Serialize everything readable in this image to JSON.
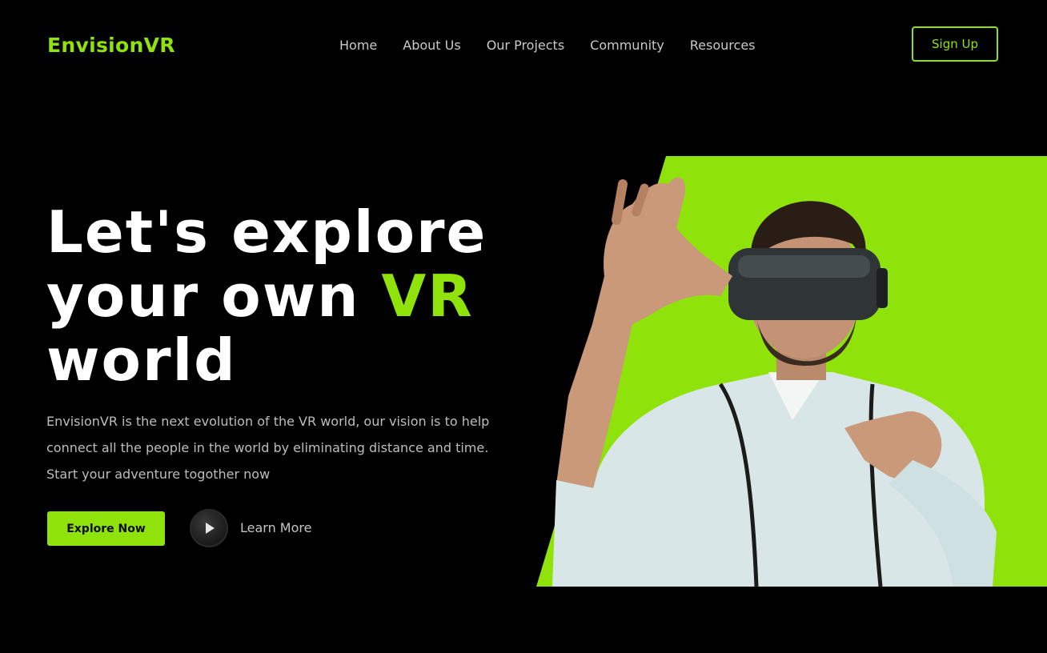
{
  "header": {
    "logo": "EnvisionVR",
    "nav": [
      {
        "label": "Home"
      },
      {
        "label": "About Us"
      },
      {
        "label": "Our Projects"
      },
      {
        "label": "Community"
      },
      {
        "label": "Resources"
      }
    ],
    "signup_label": "Sign Up"
  },
  "hero": {
    "headline_line1": "Let's explore",
    "headline_line2_start": "your own ",
    "headline_line2_accent": "VR",
    "headline_line3": "world",
    "description": "EnvisionVR is the next evolution of the VR world, our vision is to help connect all the people in the world by eliminating distance and time. Start your adventure togother now",
    "explore_label": "Explore Now",
    "learn_more_label": "Learn More",
    "image_icon": "vr-headset-person-image"
  },
  "colors": {
    "accent": "#8fe30a",
    "background": "#000000",
    "text_primary": "#ffffff",
    "text_muted": "#bdbdbd"
  }
}
